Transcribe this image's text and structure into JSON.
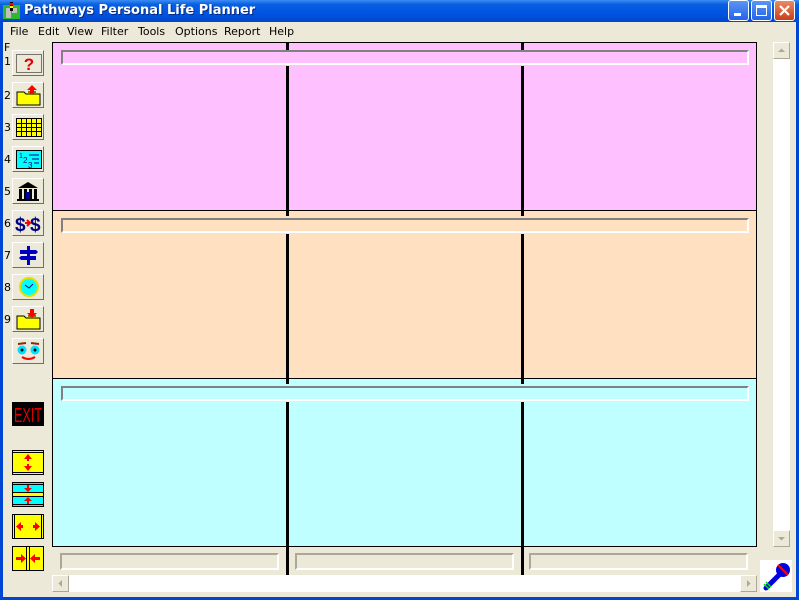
{
  "window": {
    "title": "Pathways Personal Life Planner",
    "controls": {
      "minimize": "minimize",
      "maximize": "maximize",
      "close": "close"
    }
  },
  "menu": [
    "File",
    "Edit",
    "View",
    "Filter",
    "Tools",
    "Options",
    "Report",
    "Help"
  ],
  "toolbar": {
    "header_label": "F",
    "buttons": [
      {
        "key": "1",
        "icon": "help-question-icon"
      },
      {
        "key": "2",
        "icon": "folder-open-up-icon"
      },
      {
        "key": "3",
        "icon": "grid-calendar-icon"
      },
      {
        "key": "4",
        "icon": "numbered-list-icon"
      },
      {
        "key": "5",
        "icon": "bank-building-icon"
      },
      {
        "key": "6",
        "icon": "money-transfer-icon"
      },
      {
        "key": "7",
        "icon": "signpost-icon"
      },
      {
        "key": "8",
        "icon": "clock-icon"
      },
      {
        "key": "9",
        "icon": "folder-save-down-icon"
      },
      {
        "key": "",
        "icon": "smiley-face-icon"
      }
    ],
    "exit_label": "EXIT",
    "layout_buttons": [
      {
        "icon": "expand-vertical-icon"
      },
      {
        "icon": "collapse-vertical-icon"
      },
      {
        "icon": "expand-horizontal-icon"
      },
      {
        "icon": "collapse-horizontal-icon"
      }
    ]
  },
  "panels": [
    {
      "name": "panel-top",
      "color": "#ffc0ff",
      "field_value": ""
    },
    {
      "name": "panel-middle",
      "color": "#ffe0c0",
      "field_value": ""
    },
    {
      "name": "panel-bottom",
      "color": "#c0ffff",
      "field_value": ""
    }
  ],
  "bottom_fields": [
    "",
    "",
    ""
  ]
}
